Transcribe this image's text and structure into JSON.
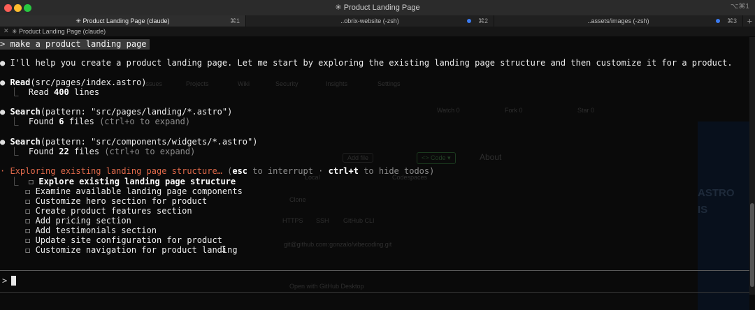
{
  "window": {
    "title": "✳ Product Landing Page",
    "shortcut": "⌥⌘1",
    "colors": {
      "close": "#ff5f57",
      "minimize": "#febc2e",
      "zoom": "#28c840"
    }
  },
  "tabs": [
    {
      "label": "✳ Product Landing Page (claude)",
      "key": "⌘1",
      "active": true,
      "dot": false
    },
    {
      "label": "..obrix-website (-zsh)",
      "key": "⌘2",
      "active": false,
      "dot": true
    },
    {
      "label": "..assets/images (-zsh)",
      "key": "⌘3",
      "active": false,
      "dot": true
    }
  ],
  "new_tab_label": "+",
  "pane": {
    "close_label": "✕",
    "title": "✳ Product Landing Page (claude)"
  },
  "background": {
    "nav": [
      "Issues",
      "Projects",
      "Wiki",
      "Security",
      "Insights",
      "Settings"
    ],
    "watch": "Watch 0",
    "fork": "Fork 0",
    "star": "Star 0",
    "add_file": "Add file",
    "code": "<> Code ▾",
    "about": "About",
    "local": "Local",
    "codespaces": "Codespaces",
    "clone": "Clone",
    "clone_tabs": [
      "HTTPS",
      "SSH",
      "GitHub CLI"
    ],
    "clone_url": "git@github.com:gonzalo/vibecoding.git",
    "desktop": "Open with GitHub Desktop",
    "side_text_1": "ASTRO",
    "side_text_2": "IS"
  },
  "terminal": {
    "command_prompt": "> make a product landing page",
    "intro": "I'll help you create a product landing page. Let me start by exploring the existing landing page structure and then customize it for a product.",
    "tools": [
      {
        "name": "Read",
        "args": "(src/pages/index.astro)",
        "result_prefix": "Read ",
        "result_bold": "400",
        "result_suffix": " lines",
        "hint": ""
      },
      {
        "name": "Search",
        "args": "(pattern: \"src/pages/landing/*.astro\")",
        "result_prefix": "Found ",
        "result_bold": "6",
        "result_suffix": " files",
        "hint": " (ctrl+o to expand)"
      },
      {
        "name": "Search",
        "args": "(pattern: \"src/components/widgets/*.astro\")",
        "result_prefix": "Found ",
        "result_bold": "22",
        "result_suffix": " files",
        "hint": " (ctrl+o to expand)"
      }
    ],
    "status": {
      "text": "Exploring existing landing page structure…",
      "hint_open": " (",
      "esc": "esc",
      "mid": " to interrupt · ",
      "ctrl": "ctrl+t",
      "hint_close": " to hide todos)"
    },
    "todos": [
      {
        "label": "Explore existing landing page structure",
        "current": true
      },
      {
        "label": "Examine available landing page components",
        "current": false
      },
      {
        "label": "Customize hero section for product",
        "current": false
      },
      {
        "label": "Create product features section",
        "current": false
      },
      {
        "label": "Add pricing section",
        "current": false
      },
      {
        "label": "Add testimonials section",
        "current": false
      },
      {
        "label": "Update site configuration for product",
        "current": false
      },
      {
        "label": "Customize navigation for product landing",
        "current": false
      }
    ],
    "input_prompt": ">",
    "input_value": ""
  }
}
